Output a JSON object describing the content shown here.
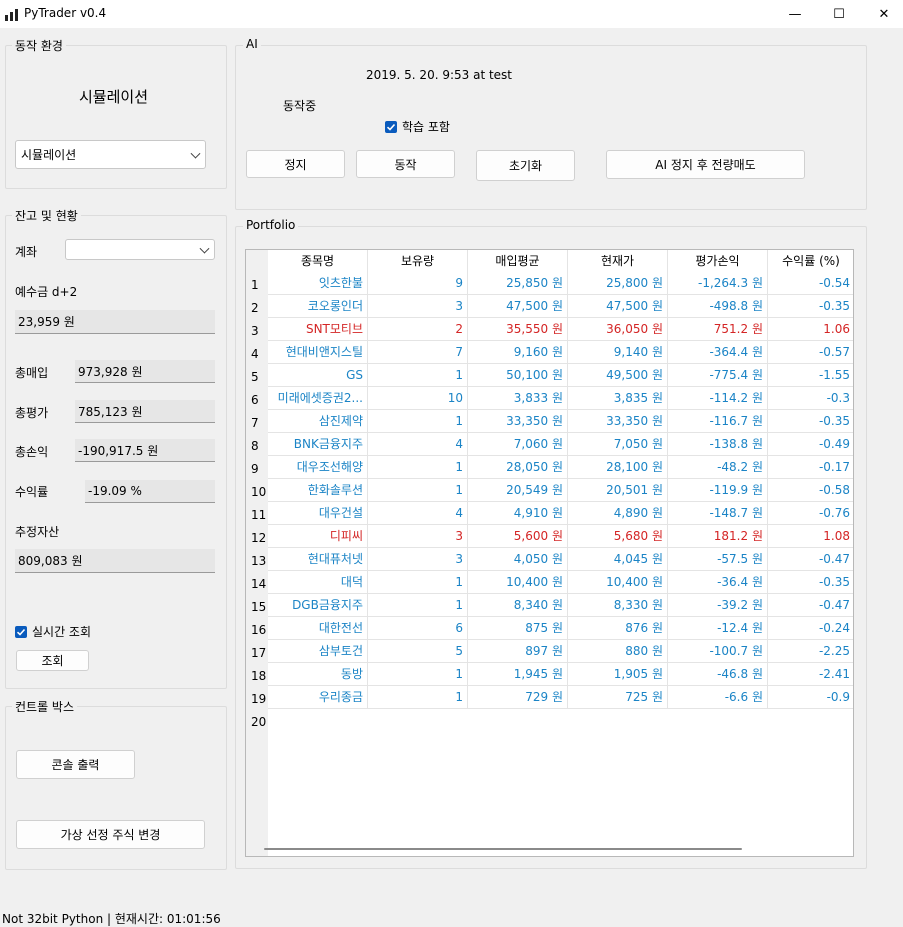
{
  "window": {
    "title": "PyTrader v0.4",
    "minimize": "—",
    "maximize": "☐",
    "close": "✕"
  },
  "env": {
    "group_title": "동작 환경",
    "mode_label": "시뮬레이션",
    "mode_select": "시뮬레이션"
  },
  "balance": {
    "group_title": "잔고 및 현황",
    "account_label": "계좌",
    "account_value": "",
    "deposit_label": "예수금 d+2",
    "deposit_value": "23,959 원",
    "total_buy_label": "총매입",
    "total_buy_value": "973,928 원",
    "total_eval_label": "총평가",
    "total_eval_value": "785,123 원",
    "total_pl_label": "총손익",
    "total_pl_value": "-190,917.5 원",
    "yield_label": "수익률",
    "yield_value": "-19.09 %",
    "est_assets_label": "추정자산",
    "est_assets_value": "809,083 원",
    "realtime_label": "실시간 조회",
    "realtime_checked": true,
    "query_button": "조회"
  },
  "control": {
    "group_title": "컨트롤 박스",
    "console_button": "콘솔 출력",
    "virtual_button": "가상 선정 주식 변경"
  },
  "ai": {
    "group_title": "AI",
    "timestamp": "2019. 5. 20. 9:53 at test",
    "status": "동작중",
    "learn_label": "학습 포함",
    "learn_checked": true,
    "stop_button": "정지",
    "run_button": "동작",
    "reset_button": "초기화",
    "stop_sell_button": "AI 정지 후 전량매도"
  },
  "portfolio": {
    "group_title": "Portfolio",
    "columns": [
      "종목명",
      "보유량",
      "매입평균",
      "현재가",
      "평가손익",
      "수익률 (%)"
    ],
    "rows": [
      {
        "n": "1",
        "name": "잇츠한불",
        "qty": "9",
        "avg": "25,850 원",
        "cur": "25,800 원",
        "pl": "-1,264.3 원",
        "rate": "-0.54",
        "up": false
      },
      {
        "n": "2",
        "name": "코오롱인더",
        "qty": "3",
        "avg": "47,500 원",
        "cur": "47,500 원",
        "pl": "-498.8 원",
        "rate": "-0.35",
        "up": false
      },
      {
        "n": "3",
        "name": "SNT모티브",
        "qty": "2",
        "avg": "35,550 원",
        "cur": "36,050 원",
        "pl": "751.2 원",
        "rate": "1.06",
        "up": true
      },
      {
        "n": "4",
        "name": "현대비앤지스틸",
        "qty": "7",
        "avg": "9,160 원",
        "cur": "9,140 원",
        "pl": "-364.4 원",
        "rate": "-0.57",
        "up": false
      },
      {
        "n": "5",
        "name": "GS",
        "qty": "1",
        "avg": "50,100 원",
        "cur": "49,500 원",
        "pl": "-775.4 원",
        "rate": "-1.55",
        "up": false
      },
      {
        "n": "6",
        "name": "미래에셋증권2...",
        "qty": "10",
        "avg": "3,833 원",
        "cur": "3,835 원",
        "pl": "-114.2 원",
        "rate": "-0.3",
        "up": false
      },
      {
        "n": "7",
        "name": "삼진제약",
        "qty": "1",
        "avg": "33,350 원",
        "cur": "33,350 원",
        "pl": "-116.7 원",
        "rate": "-0.35",
        "up": false
      },
      {
        "n": "8",
        "name": "BNK금융지주",
        "qty": "4",
        "avg": "7,060 원",
        "cur": "7,050 원",
        "pl": "-138.8 원",
        "rate": "-0.49",
        "up": false
      },
      {
        "n": "9",
        "name": "대우조선해양",
        "qty": "1",
        "avg": "28,050 원",
        "cur": "28,100 원",
        "pl": "-48.2 원",
        "rate": "-0.17",
        "up": false
      },
      {
        "n": "10",
        "name": "한화솔루션",
        "qty": "1",
        "avg": "20,549 원",
        "cur": "20,501 원",
        "pl": "-119.9 원",
        "rate": "-0.58",
        "up": false
      },
      {
        "n": "11",
        "name": "대우건설",
        "qty": "4",
        "avg": "4,910 원",
        "cur": "4,890 원",
        "pl": "-148.7 원",
        "rate": "-0.76",
        "up": false
      },
      {
        "n": "12",
        "name": "디피씨",
        "qty": "3",
        "avg": "5,600 원",
        "cur": "5,680 원",
        "pl": "181.2 원",
        "rate": "1.08",
        "up": true
      },
      {
        "n": "13",
        "name": "현대퓨처넷",
        "qty": "3",
        "avg": "4,050 원",
        "cur": "4,045 원",
        "pl": "-57.5 원",
        "rate": "-0.47",
        "up": false
      },
      {
        "n": "14",
        "name": "대덕",
        "qty": "1",
        "avg": "10,400 원",
        "cur": "10,400 원",
        "pl": "-36.4 원",
        "rate": "-0.35",
        "up": false
      },
      {
        "n": "15",
        "name": "DGB금융지주",
        "qty": "1",
        "avg": "8,340 원",
        "cur": "8,330 원",
        "pl": "-39.2 원",
        "rate": "-0.47",
        "up": false
      },
      {
        "n": "16",
        "name": "대한전선",
        "qty": "6",
        "avg": "875 원",
        "cur": "876 원",
        "pl": "-12.4 원",
        "rate": "-0.24",
        "up": false
      },
      {
        "n": "17",
        "name": "삼부토건",
        "qty": "5",
        "avg": "897 원",
        "cur": "880 원",
        "pl": "-100.7 원",
        "rate": "-2.25",
        "up": false
      },
      {
        "n": "18",
        "name": "동방",
        "qty": "1",
        "avg": "1,945 원",
        "cur": "1,905 원",
        "pl": "-46.8 원",
        "rate": "-2.41",
        "up": false
      },
      {
        "n": "19",
        "name": "우리종금",
        "qty": "1",
        "avg": "729 원",
        "cur": "725 원",
        "pl": "-6.6 원",
        "rate": "-0.9",
        "up": false
      }
    ],
    "empty_row": "20"
  },
  "status_bar": "Not 32bit Python | 현재시간: 01:01:56",
  "colors": {
    "up": "#d42525",
    "down": "#1b84c6",
    "check": "#0a5bbd"
  }
}
